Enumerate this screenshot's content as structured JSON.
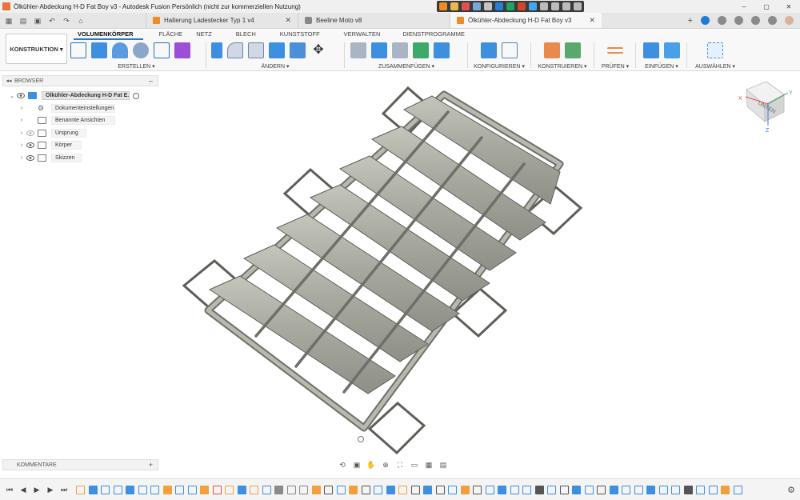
{
  "window": {
    "title": "Ölkühler-Abdeckung H-D Fat Boy v3 - Autodesk Fusion Persönlich (nicht zur kommerziellen Nutzung)",
    "controls": [
      "–",
      "▢",
      "✕"
    ]
  },
  "tabs": [
    {
      "label": "Halterung Ladestecker Typ 1 v4",
      "close": "✕",
      "icon_color": "#f08a24",
      "active": false
    },
    {
      "label": "Beeline Moto v8",
      "close": "",
      "icon_color": "#888888",
      "active": false
    },
    {
      "label": "Ölkühler-Abdeckung H-D Fat Boy v3",
      "close": "✕",
      "icon_color": "#f08a24",
      "active": true
    }
  ],
  "ribbon": {
    "workspace": "KONSTRUKTION ▾",
    "tabs": [
      "VOLUMENKÖRPER",
      "FLÄCHE",
      "NETZ",
      "BLECH",
      "KUNSTSTOFF",
      "VERWALTEN",
      "DIENSTPROGRAMME"
    ],
    "active_tab": "VOLUMENKÖRPER",
    "groups": [
      {
        "label": "ERSTELLEN ▾"
      },
      {
        "label": "ÄNDERN ▾"
      },
      {
        "label": "ZUSAMMENFÜGEN ▾"
      },
      {
        "label": "KONFIGURIEREN ▾"
      },
      {
        "label": "KONSTRUIEREN ▾"
      },
      {
        "label": "PRÜFEN ▾"
      },
      {
        "label": "EINFÜGEN ▾"
      },
      {
        "label": "AUSWÄHLEN ▾"
      }
    ]
  },
  "browser": {
    "title": "BROWSER",
    "root": "Ölkühler-Abdeckung H-D Fat E...",
    "items": [
      {
        "label": "Dokumenteinstellungen"
      },
      {
        "label": "Benannte Ansichten"
      },
      {
        "label": "Ursprung"
      },
      {
        "label": "Körper"
      },
      {
        "label": "Skizzen"
      }
    ]
  },
  "viewcube": {
    "face": "UNTEN",
    "axis_x": "X",
    "axis_y": "Y",
    "axis_z": "Z"
  },
  "comments": {
    "label": "KOMMENTARE",
    "add": "+"
  },
  "colors": {
    "accent": "#1e7bd6",
    "model_fill": "#a4a59b",
    "model_stroke": "#555650",
    "fusion_orange": "#f08a24"
  }
}
